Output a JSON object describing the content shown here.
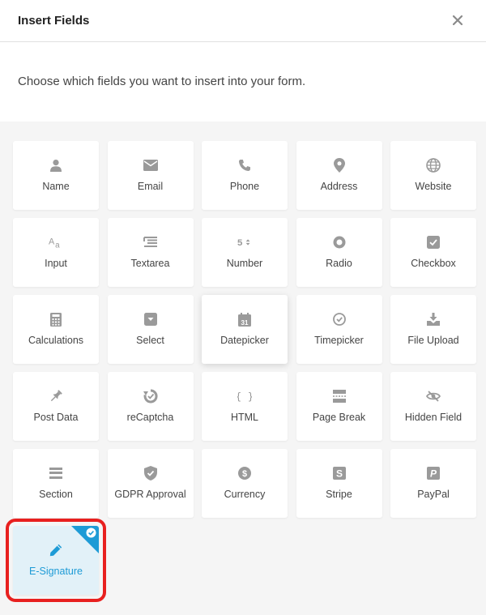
{
  "dialog": {
    "title": "Insert Fields",
    "subtitle": "Choose which fields you want to insert into your form."
  },
  "fields": [
    {
      "label": "Name",
      "icon": "user-icon"
    },
    {
      "label": "Email",
      "icon": "envelope-icon"
    },
    {
      "label": "Phone",
      "icon": "phone-icon"
    },
    {
      "label": "Address",
      "icon": "map-pin-icon"
    },
    {
      "label": "Website",
      "icon": "globe-icon"
    },
    {
      "label": "Input",
      "icon": "text-input-icon"
    },
    {
      "label": "Textarea",
      "icon": "textarea-icon"
    },
    {
      "label": "Number",
      "icon": "number-icon"
    },
    {
      "label": "Radio",
      "icon": "radio-icon"
    },
    {
      "label": "Checkbox",
      "icon": "checkbox-icon"
    },
    {
      "label": "Calculations",
      "icon": "calculator-icon"
    },
    {
      "label": "Select",
      "icon": "select-icon"
    },
    {
      "label": "Datepicker",
      "icon": "calendar-icon"
    },
    {
      "label": "Timepicker",
      "icon": "clock-icon"
    },
    {
      "label": "File Upload",
      "icon": "upload-icon"
    },
    {
      "label": "Post Data",
      "icon": "pin-icon"
    },
    {
      "label": "reCaptcha",
      "icon": "recaptcha-icon"
    },
    {
      "label": "HTML",
      "icon": "code-braces-icon"
    },
    {
      "label": "Page Break",
      "icon": "page-break-icon"
    },
    {
      "label": "Hidden Field",
      "icon": "eye-slash-icon"
    },
    {
      "label": "Section",
      "icon": "section-icon"
    },
    {
      "label": "GDPR Approval",
      "icon": "shield-check-icon"
    },
    {
      "label": "Currency",
      "icon": "dollar-icon"
    },
    {
      "label": "Stripe",
      "icon": "stripe-icon"
    },
    {
      "label": "PayPal",
      "icon": "paypal-icon"
    },
    {
      "label": "E-Signature",
      "icon": "pencil-icon"
    }
  ],
  "colors": {
    "icon": "#9a9a9a",
    "accent": "#1e9bd6",
    "selected_bg": "#e2f1f8",
    "highlight_border": "#e8201f"
  }
}
